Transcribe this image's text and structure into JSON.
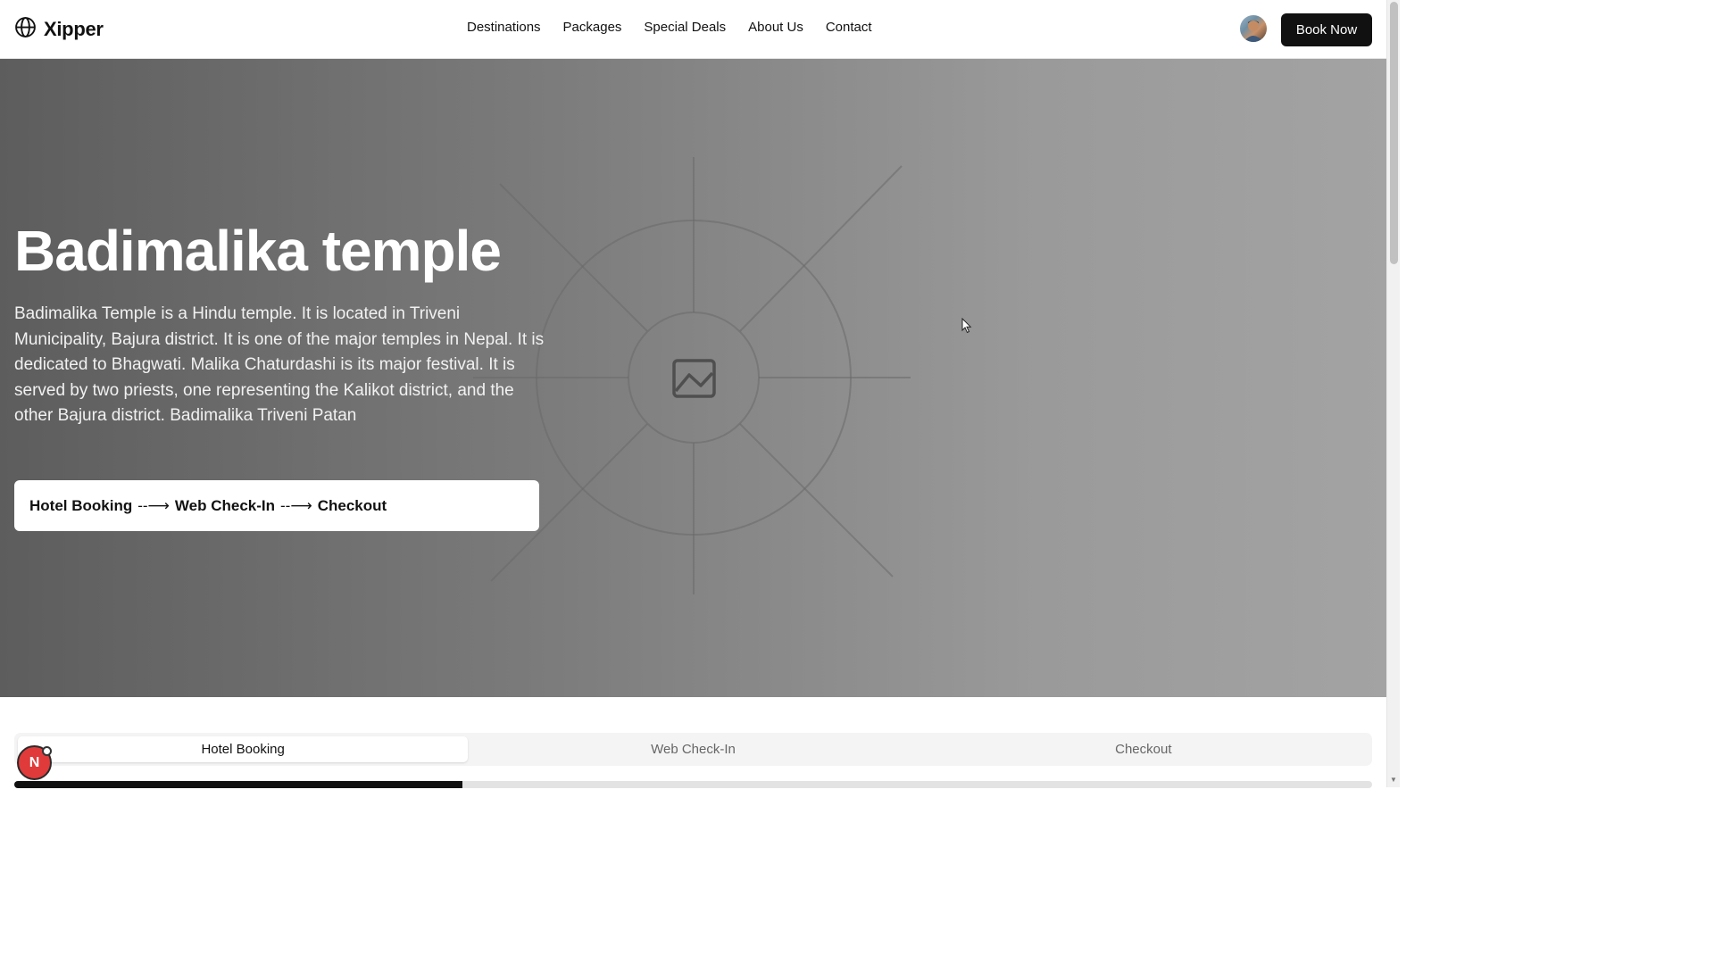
{
  "header": {
    "brand": "Xipper",
    "nav": [
      "Destinations",
      "Packages",
      "Special Deals",
      "About Us",
      "Contact"
    ],
    "book_label": "Book Now"
  },
  "hero": {
    "title": "Badimalika temple",
    "description": "Badimalika Temple is a Hindu temple. It is located in Triveni Municipality, Bajura district. It is one of the major temples in Nepal. It is dedicated to Bhagwati. Malika Chaturdashi is its major festival. It is served by two priests, one representing the Kalikot district, and the other Bajura district. Badimalika Triveni Patan",
    "flow": {
      "steps": [
        "Hotel Booking",
        "Web Check-In",
        "Checkout"
      ],
      "arrow": "--⟶"
    }
  },
  "tabs": {
    "items": [
      "Hotel Booking",
      "Web Check-In",
      "Checkout"
    ],
    "active": 0
  },
  "progress": {
    "fraction": 0.33
  },
  "fab": {
    "label": "N"
  },
  "icons": {
    "logo": "globe-icon",
    "hero_image": "image-placeholder-icon",
    "cursor": "cursor-icon"
  }
}
